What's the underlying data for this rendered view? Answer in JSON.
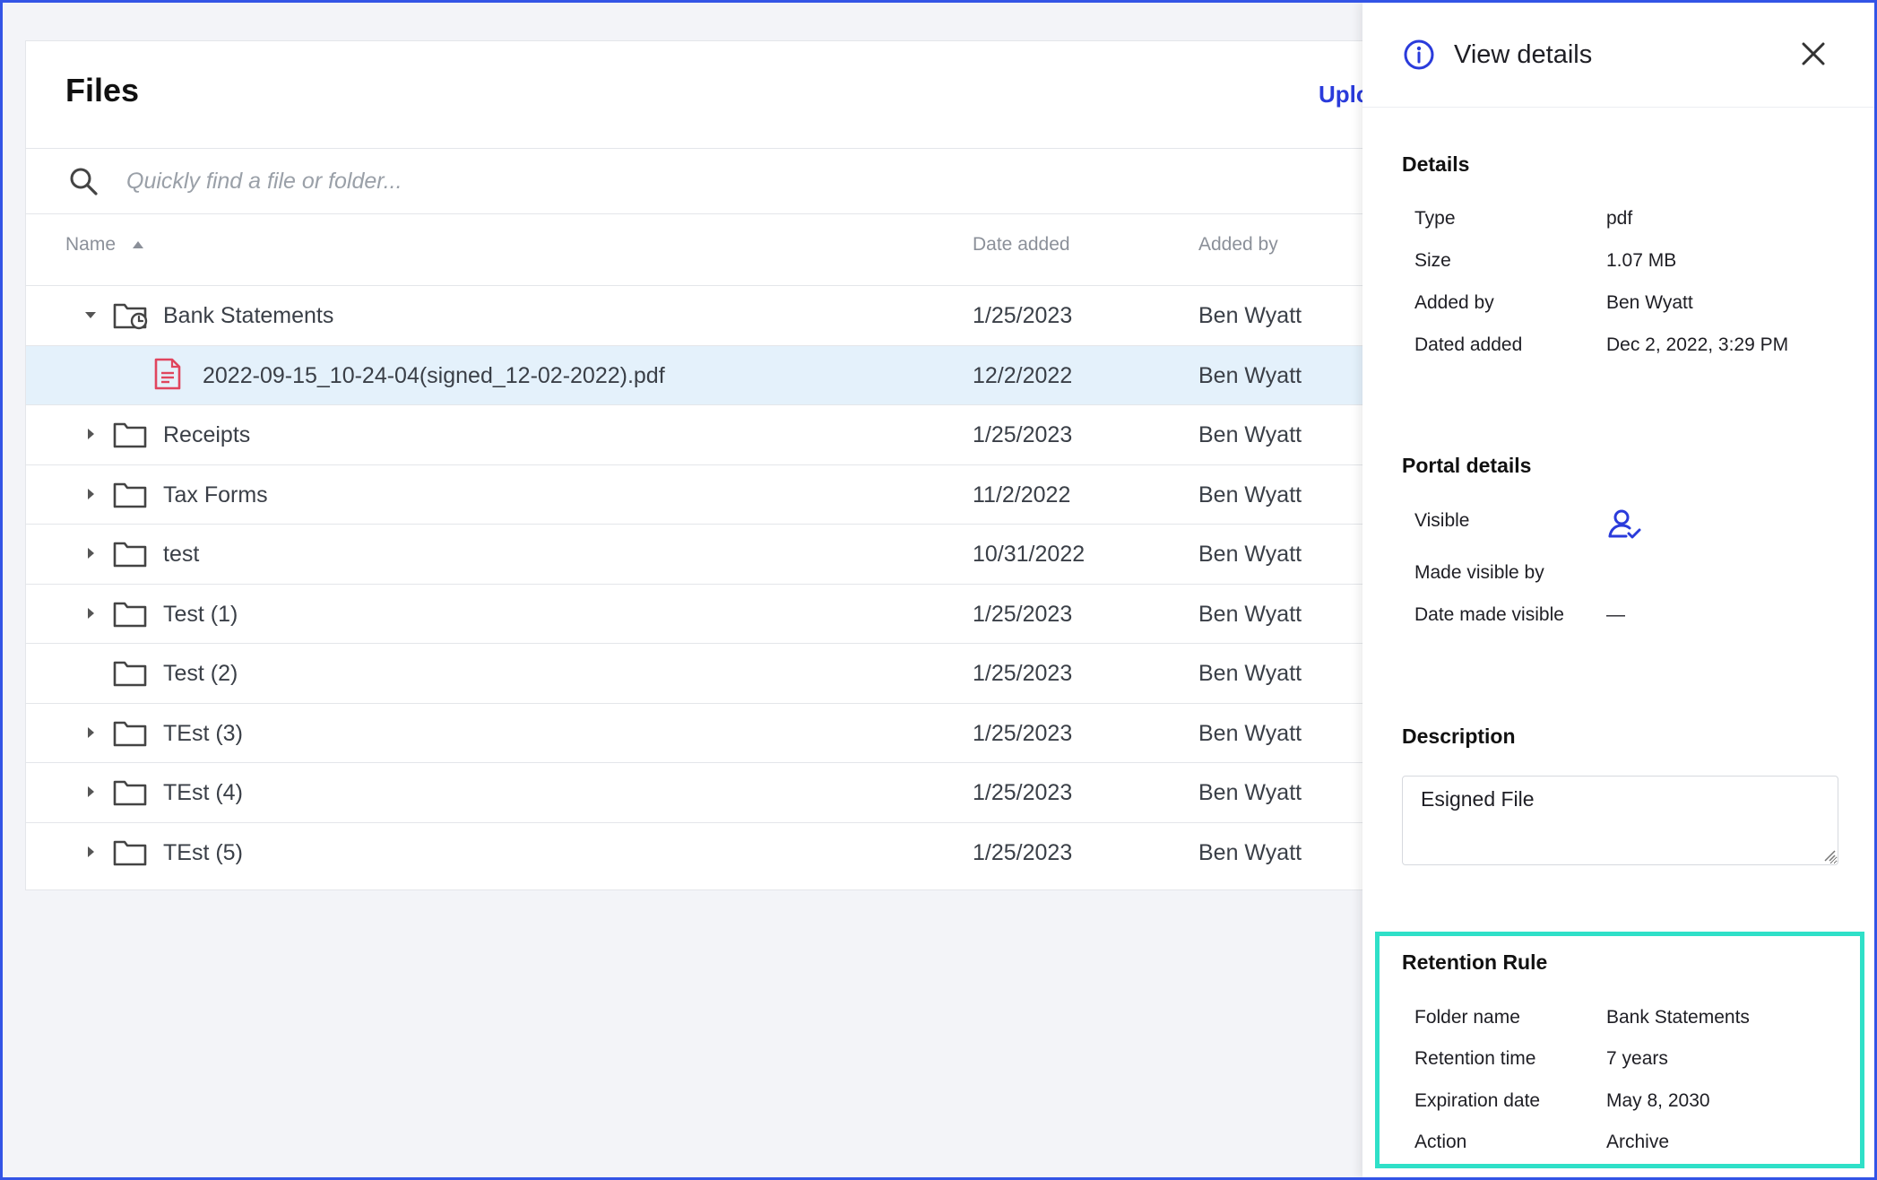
{
  "files": {
    "title": "Files",
    "upload_label": "Uplo",
    "search_placeholder": "Quickly find a file or folder...",
    "columns": {
      "name": "Name",
      "date_added": "Date added",
      "added_by": "Added by"
    },
    "rows": [
      {
        "name": "Bank Statements",
        "date": "1/25/2023",
        "by": "Ben Wyatt",
        "type": "folder-clock",
        "expanded": true
      },
      {
        "name": "2022-09-15_10-24-04(signed_12-02-2022).pdf",
        "date": "12/2/2022",
        "by": "Ben Wyatt",
        "type": "pdf",
        "selected": true
      },
      {
        "name": "Receipts",
        "date": "1/25/2023",
        "by": "Ben Wyatt",
        "type": "folder"
      },
      {
        "name": "Tax Forms",
        "date": "11/2/2022",
        "by": "Ben Wyatt",
        "type": "folder"
      },
      {
        "name": "test",
        "date": "10/31/2022",
        "by": "Ben Wyatt",
        "type": "folder"
      },
      {
        "name": "Test (1)",
        "date": "1/25/2023",
        "by": "Ben Wyatt",
        "type": "folder"
      },
      {
        "name": "Test (2)",
        "date": "1/25/2023",
        "by": "Ben Wyatt",
        "type": "folder",
        "no_caret": true
      },
      {
        "name": "TEst (3)",
        "date": "1/25/2023",
        "by": "Ben Wyatt",
        "type": "folder"
      },
      {
        "name": "TEst (4)",
        "date": "1/25/2023",
        "by": "Ben Wyatt",
        "type": "folder"
      },
      {
        "name": "TEst (5)",
        "date": "1/25/2023",
        "by": "Ben Wyatt",
        "type": "folder"
      }
    ]
  },
  "panel": {
    "title": "View details",
    "details": {
      "heading": "Details",
      "type_label": "Type",
      "type_value": "pdf",
      "size_label": "Size",
      "size_value": "1.07 MB",
      "added_by_label": "Added by",
      "added_by_value": "Ben Wyatt",
      "date_added_label": "Dated added",
      "date_added_value": "Dec 2, 2022, 3:29 PM"
    },
    "portal": {
      "heading": "Portal details",
      "visible_label": "Visible",
      "made_visible_by_label": "Made visible by",
      "date_made_visible_label": "Date made visible",
      "date_made_visible_value": "—"
    },
    "description": {
      "heading": "Description",
      "value": "Esigned File"
    },
    "retention": {
      "heading": "Retention Rule",
      "folder_label": "Folder name",
      "folder_value": "Bank Statements",
      "time_label": "Retention time",
      "time_value": "7 years",
      "expiration_label": "Expiration date",
      "expiration_value": "May 8, 2030",
      "action_label": "Action",
      "action_value": "Archive"
    }
  },
  "colors": {
    "accent": "#2a3bdb",
    "highlight": "#2fe0c8",
    "selected_row": "#e4f1fb",
    "pdf_icon": "#e0455e"
  }
}
